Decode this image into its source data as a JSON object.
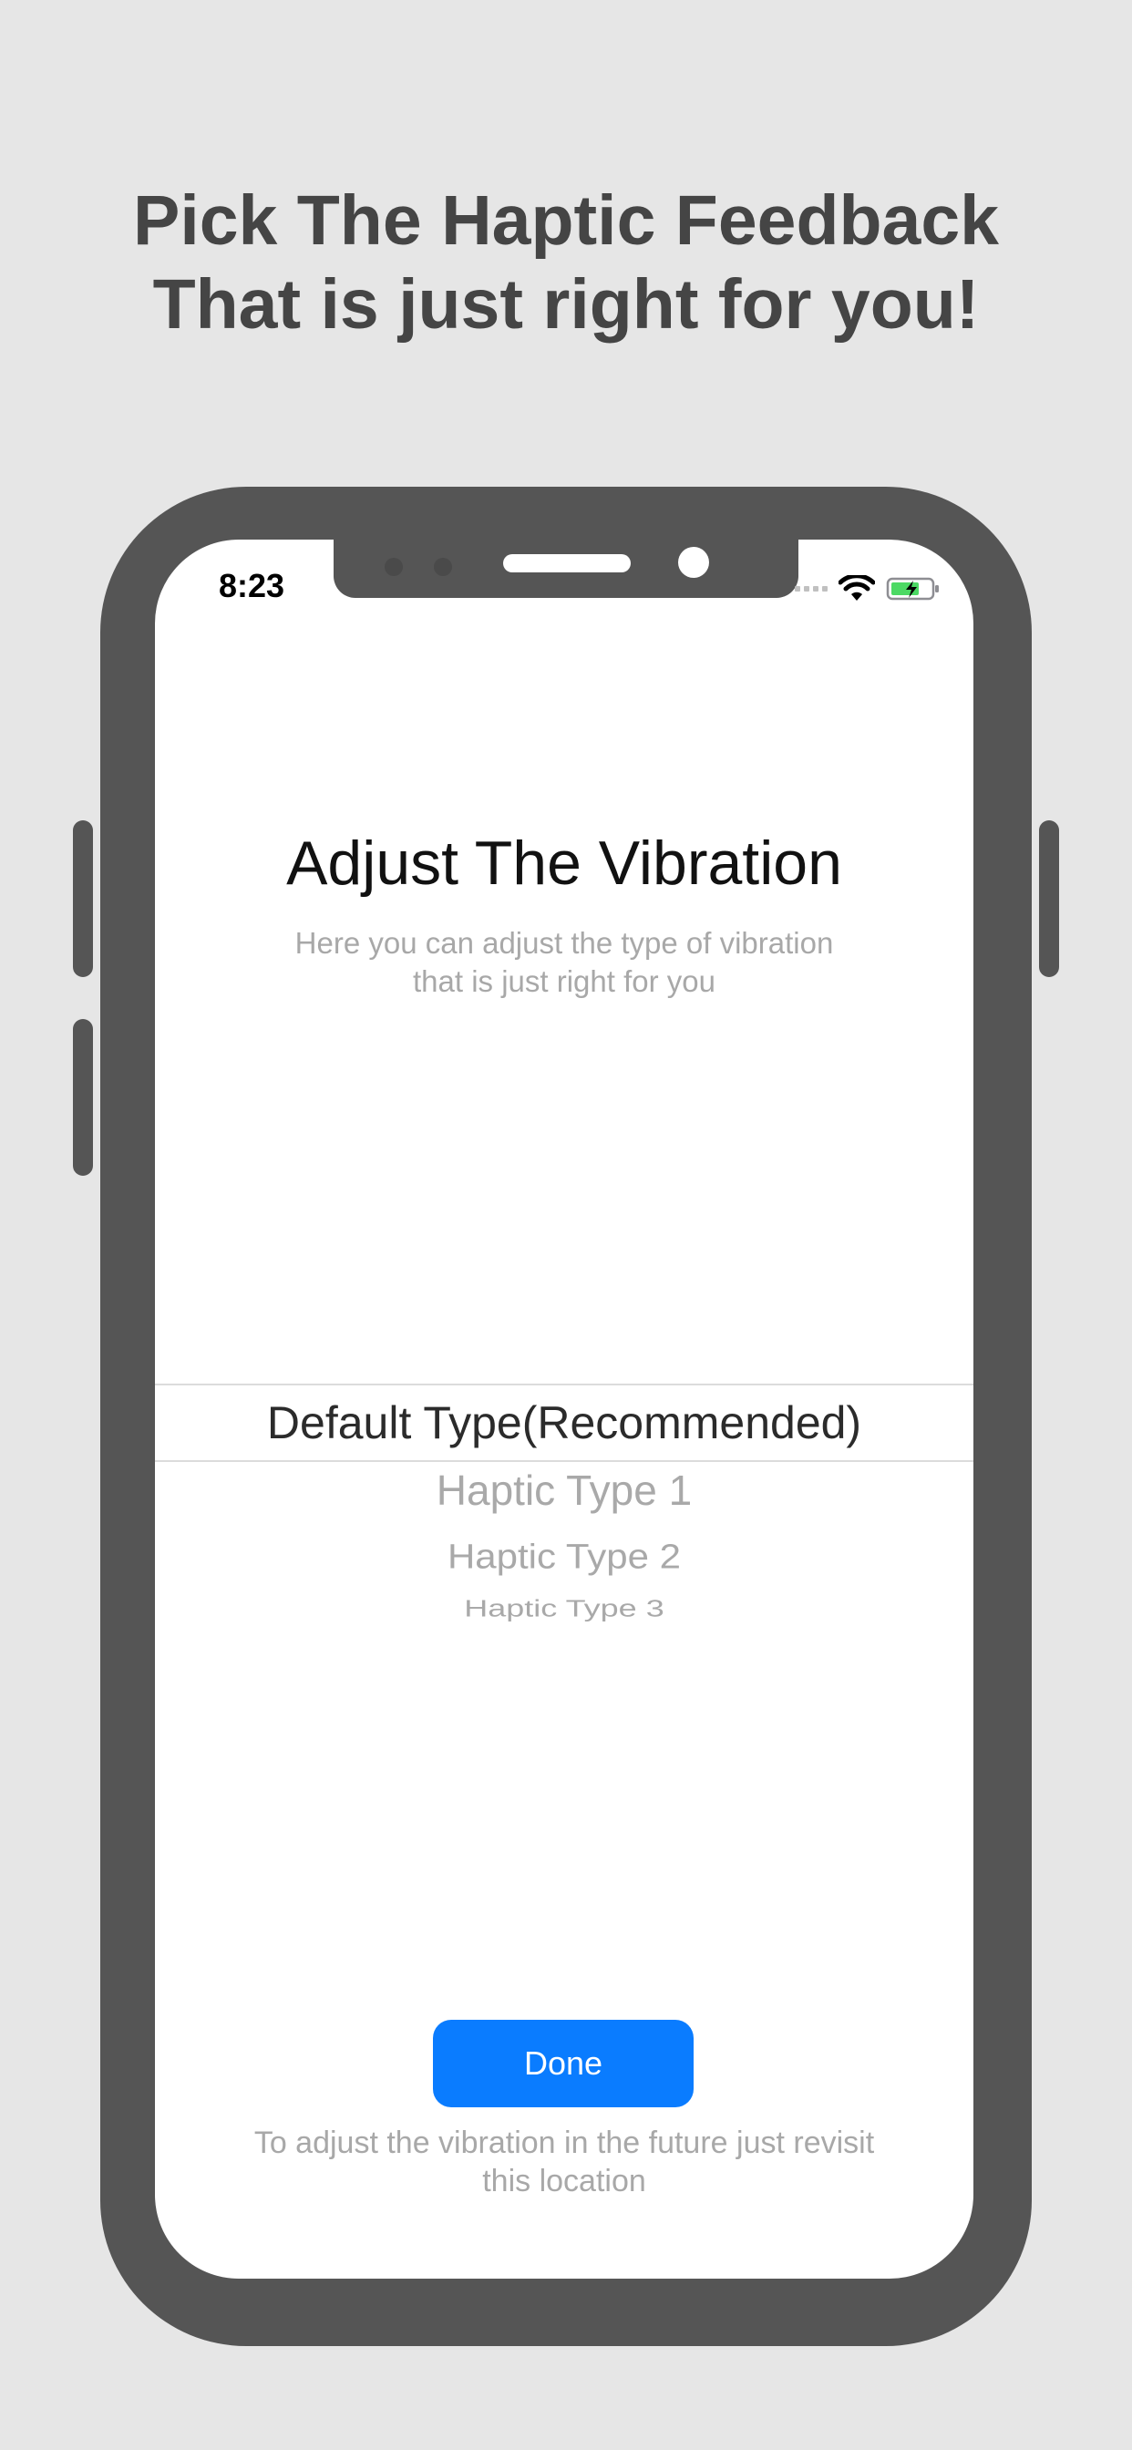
{
  "headline": {
    "line1": "Pick The Haptic Feedback",
    "line2": "That is just right for you!"
  },
  "status_bar": {
    "time": "8:23",
    "icons": [
      "cellular-signal-icon",
      "wifi-icon",
      "battery-charging-icon"
    ],
    "battery_color": "#4cd964"
  },
  "screen": {
    "title": "Adjust The Vibration",
    "subtitle_line1": "Here you can adjust the type of vibration",
    "subtitle_line2": "that is just right for you",
    "picker": {
      "selected": "Default Type(Recommended)",
      "options": [
        "Haptic Type 1",
        "Haptic Type 2",
        "Haptic Type 3"
      ]
    },
    "done_label": "Done",
    "footer_line1": "To adjust the vibration in the future just revisit",
    "footer_line2": "this location"
  },
  "colors": {
    "background": "#e6e6e6",
    "phone_frame": "#555555",
    "accent": "#0a7cff",
    "headline": "#454545"
  }
}
